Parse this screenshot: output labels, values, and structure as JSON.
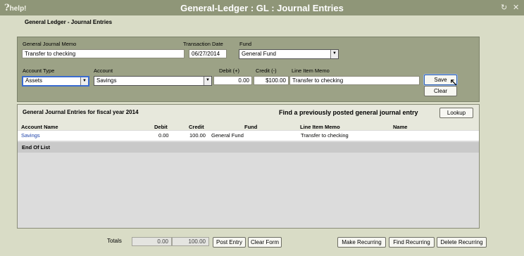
{
  "titlebar": {
    "help": "help!",
    "help_mark": "?",
    "title": "General-Ledger : GL : Journal Entries",
    "refresh_glyph": "↻",
    "close_glyph": "✕"
  },
  "page_title": "General Ledger - Journal Entries",
  "form": {
    "memo_label": "General Journal Memo",
    "memo_value": "Transfer to checking",
    "date_label": "Transaction Date",
    "date_value": "06/27/2014",
    "fund_label": "Fund",
    "fund_value": "General Fund",
    "account_type_label": "Account Type",
    "account_type_value": "Assets",
    "account_label": "Account",
    "account_value": "Savings",
    "debit_label": "Debit (+)",
    "debit_value": "0.00",
    "credit_label": "Credit (-)",
    "credit_value": "$100.00",
    "line_memo_label": "Line Item Memo",
    "line_memo_value": "Transfer to checking",
    "save_label": "Save",
    "clear_label": "Clear"
  },
  "list": {
    "title": "General Journal Entries for fiscal year 2014",
    "find_label": "Find a previously posted general journal entry",
    "lookup_label": "Lookup",
    "columns": [
      "Account Name",
      "Debit",
      "Credit",
      "Fund",
      "Line Item Memo",
      "Name"
    ],
    "rows": [
      {
        "account": "Savings",
        "debit": "0.00",
        "credit": "100.00",
        "fund": "General Fund",
        "memo": "Transfer to checking",
        "name": ""
      }
    ],
    "end_label": "End Of List"
  },
  "footer": {
    "totals_label": "Totals",
    "total_debit": "0.00",
    "total_credit": "100.00",
    "post_label": "Post Entry",
    "clear_form_label": "Clear Form",
    "make_recurring_label": "Make Recurring",
    "find_recurring_label": "Find Recurring",
    "delete_recurring_label": "Delete Recurring"
  },
  "icons": {
    "dropdown": "▼",
    "cursor": "↖"
  }
}
